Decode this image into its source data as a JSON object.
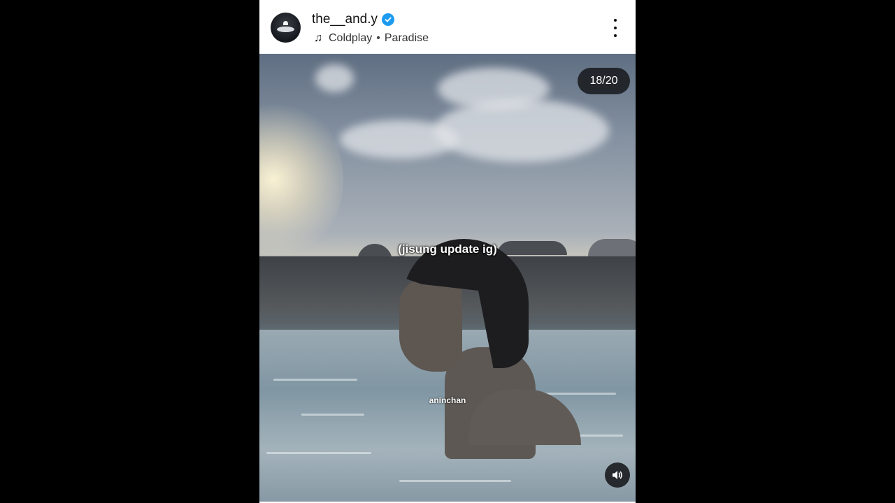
{
  "header": {
    "username": "the__and.y",
    "music": {
      "artist": "Coldplay",
      "separator": "•",
      "song": "Paradise"
    }
  },
  "media": {
    "counter": "18/20",
    "caption": "(jisung update ig)",
    "watermark": "aninchan"
  },
  "icons": {
    "verified": "verified-badge-icon",
    "music": "music-note-icon",
    "more": "more-options-icon",
    "sound": "speaker-icon"
  },
  "colors": {
    "verified": "#1d9bf0",
    "background": "#000000",
    "counter_bg": "#191b1f"
  }
}
